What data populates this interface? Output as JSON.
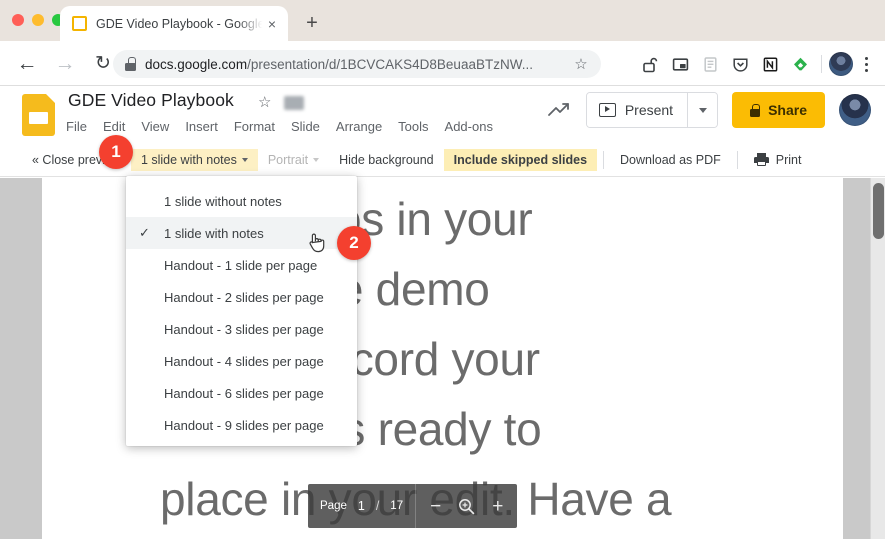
{
  "browser": {
    "tab": {
      "title": "GDE Video Playbook - Google Slides",
      "favicon": "slides-favicon",
      "close_label": "×"
    },
    "new_tab_label": "+",
    "nav": {
      "back": "←",
      "forward": "→",
      "reload": "↻"
    },
    "omnibox": {
      "lock": "lock-icon",
      "url_domain": "docs.google.com",
      "url_path": "/presentation/d/1BCVCAKS4D8BeuaaBTzNW...",
      "bookmark_star": "☆"
    },
    "extensions": [
      {
        "name": "unlocked-padlock-icon"
      },
      {
        "name": "picture-in-picture-icon"
      },
      {
        "name": "reading-list-icon"
      },
      {
        "name": "pocket-icon"
      },
      {
        "name": "notion-icon"
      },
      {
        "name": "feedly-icon"
      }
    ]
  },
  "slides": {
    "logo": "google-slides-logo",
    "doc_title": "GDE Video Playbook",
    "star": "☆",
    "menus": [
      "File",
      "Edit",
      "View",
      "Insert",
      "Format",
      "Slide",
      "Arrange",
      "Tools",
      "Add-ons"
    ],
    "present_label": "Present",
    "share_label": "Share",
    "accent_share": "#fbbc04"
  },
  "print_preview": {
    "close_label": "« Close preview",
    "layout_label": "1 slide with notes",
    "orientation_label": "Portrait",
    "hide_background_label": "Hide background",
    "include_skipped_label": "Include skipped slides",
    "download_pdf_label": "Download as PDF",
    "print_label": "Print",
    "highlight_color": "#fdf0c4"
  },
  "layout_menu": {
    "items": [
      {
        "label": "1 slide without notes",
        "checked": false
      },
      {
        "label": "1 slide with notes",
        "checked": true
      },
      {
        "label": "Handout - 1 slide per page",
        "checked": false
      },
      {
        "label": "Handout - 2 slides per page",
        "checked": false
      },
      {
        "label": "Handout - 3 slides per page",
        "checked": false
      },
      {
        "label": "Handout - 4 slides per page",
        "checked": false
      },
      {
        "label": "Handout - 6 slides per page",
        "checked": false
      },
      {
        "label": "Handout - 9 slides per page",
        "checked": false
      }
    ],
    "check_glyph": "✓"
  },
  "document_preview": {
    "text": "       demos in your\n       rd the demo\n       ou record your\n       at it is ready to\nplace in your edit. Have a"
  },
  "page_nav": {
    "page_label": "Page",
    "current_page": "1",
    "separator": "/",
    "total_pages": "17",
    "zoom_out": "−",
    "zoom_icon": "magnifier-icon",
    "zoom_in": "+"
  },
  "annotations": {
    "badge_1": "1",
    "badge_2": "2",
    "badge_color": "#f4402f"
  }
}
